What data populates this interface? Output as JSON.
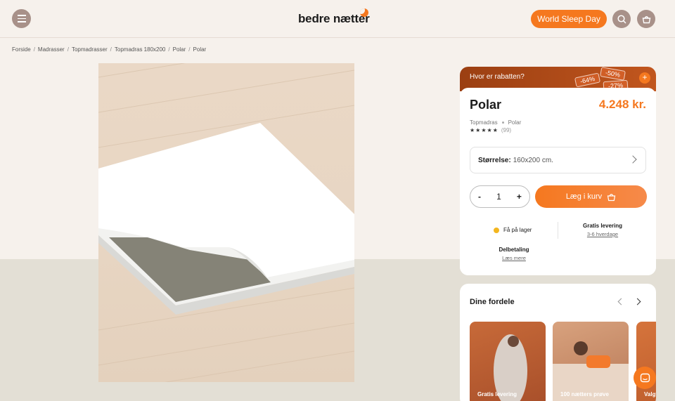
{
  "header": {
    "logo_text": "bedre nætter",
    "cta_label": "World Sleep Day"
  },
  "breadcrumb": [
    "Forside",
    "Madrasser",
    "Topmadrasser",
    "Topmadras 180x200",
    "Polar",
    "Polar"
  ],
  "promo": {
    "text": "Hvor er rabatten?",
    "tags": [
      "-64%",
      "-50%",
      "-27%"
    ],
    "plus": "+"
  },
  "product": {
    "title": "Polar",
    "price": "4.248 kr.",
    "category": "Topmadras",
    "variant": "Polar",
    "rating_stars": "★★★★★",
    "rating": 4.5,
    "reviews": "(99)",
    "size_label": "Størrelse:",
    "size_value": "160x200 cm.",
    "quantity": "1",
    "minus": "-",
    "plus": "+",
    "add_to_cart": "Læg i kurv"
  },
  "info": {
    "stock": "Få på lager",
    "delivery_title": "Gratis levering",
    "delivery_sub": "3-6 hverdage",
    "installment_title": "Delbetaling",
    "installment_link": "Læs mere"
  },
  "benefits": {
    "title": "Dine fordele",
    "cards": [
      "Gratis levering",
      "100 nætters prøve",
      "Valgfri"
    ]
  },
  "colors": {
    "accent": "#f5781f",
    "page_bg": "#f6f1ec",
    "icon_bg": "#a89189",
    "stock_dot": "#f3b61f"
  }
}
